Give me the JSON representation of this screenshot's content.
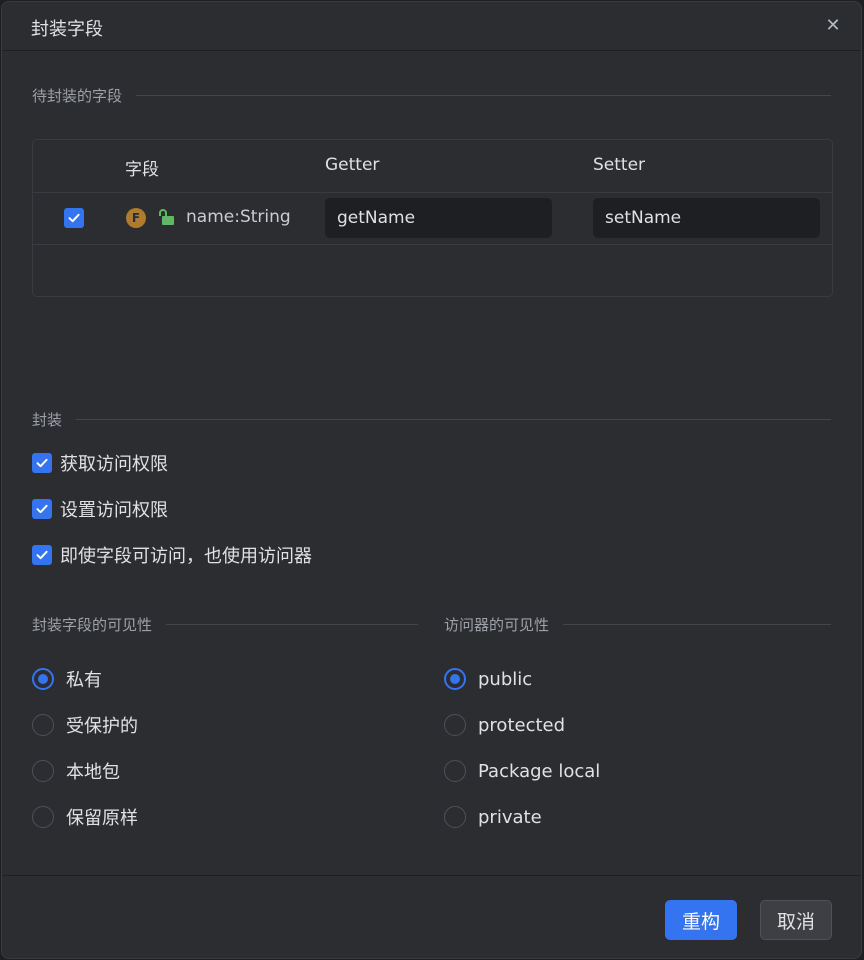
{
  "dialog": {
    "title": "封装字段",
    "close_icon": "close-icon"
  },
  "fields_section": {
    "header": "待封装的字段",
    "columns": [
      "字段",
      "Getter",
      "Setter"
    ],
    "rows": [
      {
        "checked": true,
        "field_icon_letter": "F",
        "access_icon": "unlock-icon",
        "name": "name:String",
        "getter": "getName",
        "setter": "setName"
      }
    ]
  },
  "encapsulate_section": {
    "header": "封装",
    "options": [
      {
        "label": "获取访问权限",
        "checked": true
      },
      {
        "label": "设置访问权限",
        "checked": true
      },
      {
        "label": "即使字段可访问，也使用访问器",
        "checked": true
      }
    ]
  },
  "field_visibility": {
    "header": "封装字段的可见性",
    "options": [
      "私有",
      "受保护的",
      "本地包",
      "保留原样"
    ],
    "selected": "私有"
  },
  "accessor_visibility": {
    "header": "访问器的可见性",
    "options": [
      "public",
      "protected",
      "Package local",
      "private"
    ],
    "selected": "public"
  },
  "footer": {
    "refactor_label": "重构",
    "cancel_label": "取消"
  },
  "colors": {
    "accent": "#3574f0",
    "background": "#2b2d30",
    "field_icon": "#b07b2b",
    "lock_icon": "#5fb865"
  }
}
